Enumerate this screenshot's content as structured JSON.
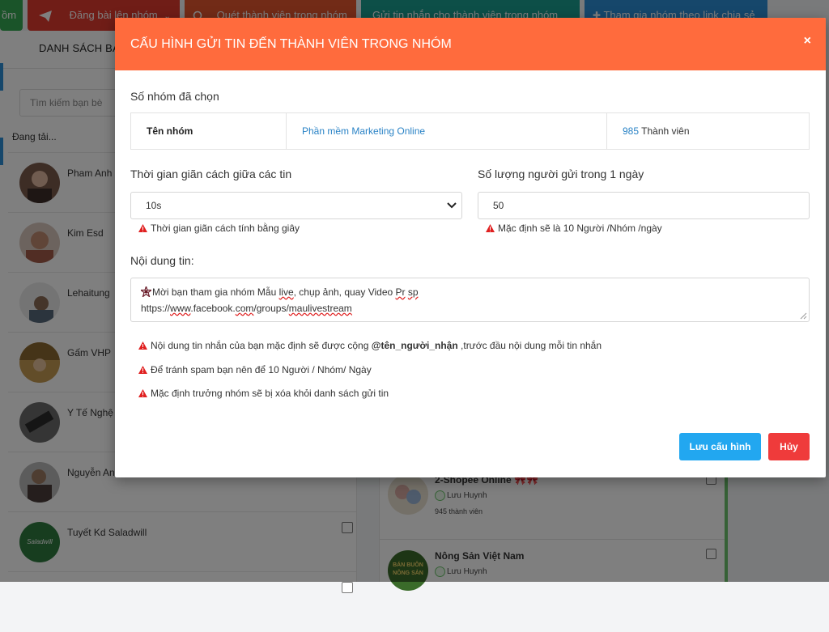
{
  "topbar": {
    "tabs": [
      {
        "label": "ồm",
        "color": "#34a853"
      },
      {
        "label": "Đăng bài lên nhóm",
        "color": "#e03b2e",
        "icon": "send-icon"
      },
      {
        "label": "Quét thành viên trong nhóm",
        "color": "#e4572e",
        "icon": "search-icon"
      },
      {
        "label": "Gửi tin nhắn cho thành viên trong nhóm",
        "color": "#1a9e90"
      },
      {
        "label": "Tham gia nhóm theo link chia sẻ",
        "color": "#2c8fd6",
        "icon": "puzzle-icon"
      }
    ]
  },
  "left_panel": {
    "tab_label": "DANH SÁCH BẠ",
    "search_placeholder": "Tìm kiếm bạn bè",
    "loading_text": "Đang tải...",
    "friends": [
      {
        "name": "Pham Anh"
      },
      {
        "name": "Kim Esd"
      },
      {
        "name": "Lehaitung"
      },
      {
        "name": "Gấm VHP"
      },
      {
        "name": "Y Tế Nghệ"
      },
      {
        "name": "Nguyễn An"
      },
      {
        "name": "Tuyết Kd Saladwill",
        "avatar_text": "Saladwill"
      }
    ]
  },
  "mid_panel": {
    "groups": [
      {
        "name": "2-Shopee Online 🎀🎀",
        "owner": "Lưu Huynh",
        "members": "945 thành viên"
      },
      {
        "name": "Nông Sản Việt Nam",
        "owner": "Lưu Huynh",
        "avatar_text": "BÁN BUÔN NÔNG SẢN"
      }
    ]
  },
  "modal": {
    "title": "CẤU HÌNH GỬI TIN ĐẾN THÀNH VIÊN TRONG NHÓM",
    "close_label": "×",
    "selected_groups_label": "Số nhóm đã chọn",
    "table": {
      "header": "Tên nhóm",
      "group_name": "Phần mềm Marketing Online",
      "member_count": "985",
      "member_suffix": "Thành viên"
    },
    "interval": {
      "label": "Thời gian giãn cách giữa các tin",
      "value": "10s",
      "hint": "Thời gian giãn cách tính bằng giây"
    },
    "daily_limit": {
      "label": "Số lượng người gửi trong 1 ngày",
      "value": "50",
      "hint": "Mặc định sẽ là 10 Người /Nhóm /ngày"
    },
    "content": {
      "label": "Nội dung tin:",
      "line1_pre": "Mời bạn tham gia nhóm Mẫu ",
      "line1_live": "live",
      "line1_mid": ", chụp ảnh, quay Video ",
      "line1_pr": "Pr",
      "line1_sp": "sp",
      "line2_pre": "https://",
      "line2_www": "www",
      "line2_mid": ".facebook.",
      "line2_com": "com",
      "line2_groups": "/groups/",
      "line2_slug": "maulivestream"
    },
    "notes": {
      "note1_pre": "Nội dung tin nhắn của bạn mặc định sẽ được cộng ",
      "note1_bold": "@tên_người_nhận",
      "note1_post": " ,trước đầu nội dung mỗi tin nhắn",
      "note2": "Để tránh spam bạn nên để 10 Người / Nhóm/ Ngày",
      "note3": "Mặc định trưởng nhóm sẽ bị xóa khỏi danh sách gửi tin"
    },
    "save_label": "Lưu cấu hình",
    "cancel_label": "Hủy"
  },
  "colors": {
    "header": "#ff6b3d",
    "save": "#22a7f0",
    "cancel": "#ef3b3b",
    "link": "#2a83c6",
    "warning": "#e02020"
  }
}
